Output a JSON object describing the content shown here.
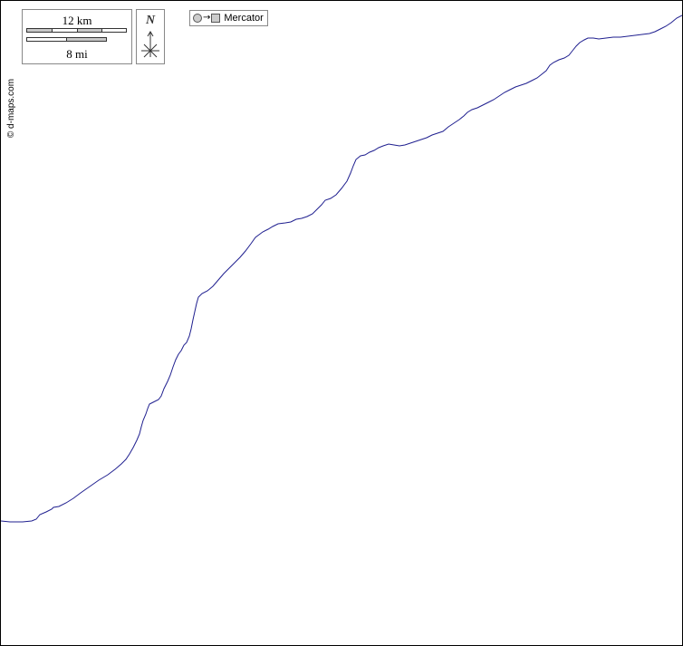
{
  "map": {
    "credit": "© d-maps.com",
    "scale": {
      "km_label": "12 km",
      "mi_label": "8 mi"
    },
    "north_label": "N",
    "projection_label": "Mercator",
    "icons": [
      "globe-circle-icon",
      "arrow-right-icon",
      "map-square-icon",
      "compass-icon"
    ],
    "colors": {
      "coastline": "#1f1f8f",
      "frame": "#000000",
      "panel_border": "#888888",
      "bar_fill": "#c8c8c8"
    }
  }
}
